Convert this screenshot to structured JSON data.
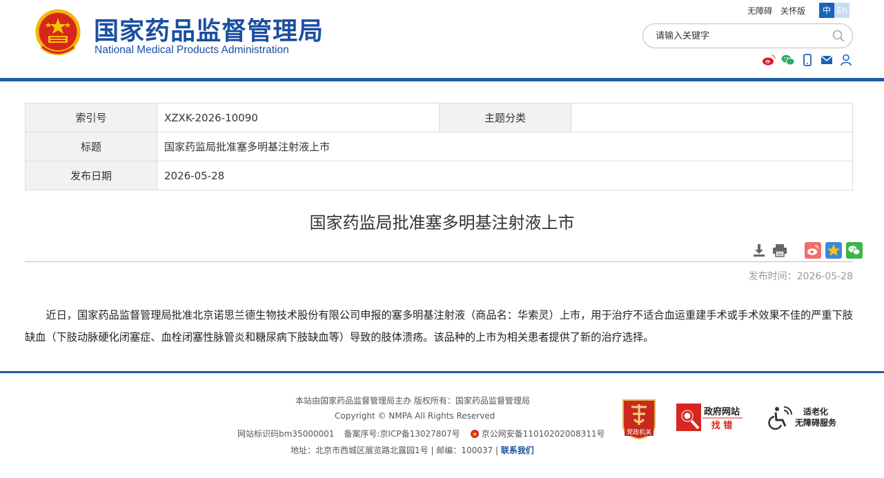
{
  "header": {
    "site_name_cn": "国家药品监督管理局",
    "site_name_en": "National Medical Products Administration",
    "top_links": [
      "无障碍",
      "关怀版"
    ],
    "lang": {
      "zh": "中",
      "en": "En"
    },
    "search_placeholder": "请输入关键字",
    "social_icons": [
      "weibo-icon",
      "wechat-icon",
      "mobile-icon",
      "mail-icon",
      "user-icon"
    ],
    "colors": {
      "brand_blue": "#1a4fa0",
      "bar_blue": "#1f5aa6"
    }
  },
  "meta": {
    "index_label": "索引号",
    "index_value": "XZXK-2026-10090",
    "topic_label": "主题分类",
    "topic_value": "",
    "title_label": "标题",
    "title_value": "国家药监局批准塞多明基注射液上市",
    "date_label": "发布日期",
    "date_value": "2026-05-28"
  },
  "article": {
    "title": "国家药监局批准塞多明基注射液上市",
    "publish_time": "发布时间：2026-05-28",
    "body": "近日，国家药品监督管理局批准北京诺思兰德生物技术股份有限公司申报的塞多明基注射液（商品名：华索灵）上市，用于治疗不适合血运重建手术或手术效果不佳的严重下肢缺血（下肢动脉硬化闭塞症、血栓闭塞性脉管炎和糖尿病下肢缺血等）导致的肢体溃疡。该品种的上市为相关患者提供了新的治疗选择。",
    "tool_icons": [
      "download-icon",
      "print-icon",
      "weibo-share-icon",
      "qzone-share-icon",
      "wechat-share-icon"
    ]
  },
  "footer": {
    "line1": "本站由国家药品监督管理局主办 版权所有：国家药品监督管理局",
    "line2": "Copyright © NMPA All Rights Reserved",
    "site_id": "网站标识码bm35000001",
    "icp": "备案序号:京ICP备13027807号",
    "police": "京公网安备11010202008311号",
    "address": "地址：北京市西城区展览路北露园1号 | 邮编：100037 | ",
    "contact": "联系我们",
    "badge_party": "党政机关",
    "badge_gov_title": "政府网站",
    "badge_gov_sub": "找 错",
    "badge_elder_1": "适老化",
    "badge_elder_2": "无障碍服务"
  }
}
